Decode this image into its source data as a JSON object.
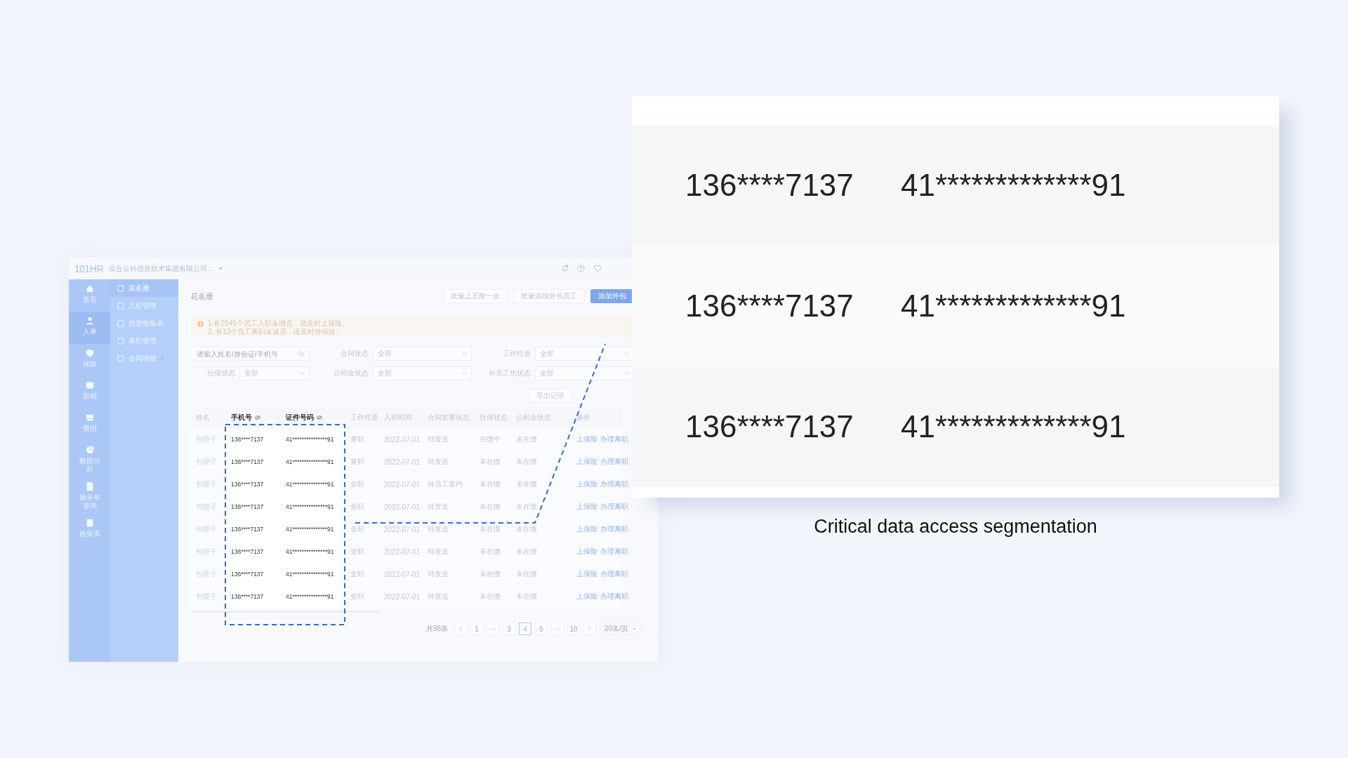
{
  "app": {
    "logo": "101HR",
    "company": "众合云科信息技术集团有限公司...",
    "rail": [
      {
        "label": "首页",
        "selected": false
      },
      {
        "label": "人事",
        "selected": true
      },
      {
        "label": "保险",
        "selected": false
      },
      {
        "label": "薪税",
        "selected": false
      },
      {
        "label": "费用",
        "selected": false
      },
      {
        "label": "数据分析",
        "selected": false
      },
      {
        "label": "服务单查询",
        "selected": false
      },
      {
        "label": "政策库",
        "selected": false
      }
    ],
    "submenu": [
      {
        "label": "花名册",
        "selected": true,
        "badge": false
      },
      {
        "label": "入职管理",
        "selected": false,
        "badge": false
      },
      {
        "label": "信息收集表",
        "selected": false,
        "badge": false
      },
      {
        "label": "离职管理",
        "selected": false,
        "badge": false
      },
      {
        "label": "合同续签",
        "selected": false,
        "badge": true
      }
    ],
    "page_title": "花名册",
    "actions": [
      {
        "label": "批量上五险一金",
        "kind": "default"
      },
      {
        "label": "批量添加外包员工",
        "kind": "default"
      },
      {
        "label": "添加外包",
        "kind": "primary"
      }
    ],
    "alerts": [
      "1.有2545个员工入职未增员，请及时上保险。",
      "2. 有13个员工离职未减员，请及时停保险。"
    ],
    "search": {
      "placeholder": "请输入姓名/身份证/手机号"
    },
    "filters": [
      {
        "label": "合同状态",
        "value": "全部"
      },
      {
        "label": "工作性质",
        "value": "全部"
      },
      {
        "label": "社保状态",
        "value": "全部"
      },
      {
        "label": "公积金状态",
        "value": "全部"
      },
      {
        "label": "补充工伤状态",
        "value": "全部"
      }
    ],
    "export_button": "导出记录",
    "table": {
      "columns": [
        "姓名",
        "手机号",
        "证件号码",
        "工作性质",
        "入职时间",
        "合同签署状态",
        "社保状态",
        "公积金状态",
        "操作"
      ],
      "rows": [
        {
          "name": "包饺子",
          "phone": "136****7137",
          "id": "41***************91",
          "work": "兼职",
          "date": "2022-07-01",
          "contract": "待发送",
          "social": "在缴中",
          "fund": "未在缴",
          "actions": [
            "上保险",
            "办理离职"
          ]
        },
        {
          "name": "包饺子",
          "phone": "136****7137",
          "id": "41***************91",
          "work": "兼职",
          "date": "2022-07-01",
          "contract": "待发送",
          "social": "未在缴",
          "fund": "未在缴",
          "actions": [
            "上保险",
            "办理离职"
          ]
        },
        {
          "name": "包饺子",
          "phone": "136****7137",
          "id": "41***************91",
          "work": "全职",
          "date": "2022-07-01",
          "contract": "待员工签约",
          "social": "未在缴",
          "fund": "未在缴",
          "actions": [
            "上保险",
            "办理离职"
          ]
        },
        {
          "name": "包饺子",
          "phone": "136****7137",
          "id": "41***************91",
          "work": "全职",
          "date": "2022-07-01",
          "contract": "待发送",
          "social": "未在缴",
          "fund": "未在缴",
          "actions": [
            "上保险",
            "办理离职"
          ]
        },
        {
          "name": "包饺子",
          "phone": "136****7137",
          "id": "41***************91",
          "work": "全职",
          "date": "2022-07-01",
          "contract": "待发送",
          "social": "未在缴",
          "fund": "未在缴",
          "actions": [
            "上保险",
            "办理离职"
          ]
        },
        {
          "name": "包饺子",
          "phone": "136****7137",
          "id": "41***************91",
          "work": "全职",
          "date": "2022-07-01",
          "contract": "待发送",
          "social": "未在缴",
          "fund": "未在缴",
          "actions": [
            "上保险",
            "办理离职"
          ]
        },
        {
          "name": "包饺子",
          "phone": "136****7137",
          "id": "41***************91",
          "work": "全职",
          "date": "2022-07-01",
          "contract": "待发送",
          "social": "未在缴",
          "fund": "未在缴",
          "actions": [
            "上保险",
            "办理离职"
          ]
        },
        {
          "name": "包饺子",
          "phone": "136****7137",
          "id": "41***************91",
          "work": "全职",
          "date": "2022-07-01",
          "contract": "待发送",
          "social": "未在缴",
          "fund": "未在缴",
          "actions": [
            "上保险",
            "办理离职"
          ]
        }
      ]
    },
    "pagination": {
      "total": "共98条",
      "pages": [
        {
          "label": "1",
          "selected": false
        },
        {
          "label": "···",
          "selected": false
        },
        {
          "label": "3",
          "selected": false
        },
        {
          "label": "4",
          "selected": true
        },
        {
          "label": "5",
          "selected": false
        },
        {
          "label": "···",
          "selected": false
        },
        {
          "label": "10",
          "selected": false
        }
      ],
      "page_size": "20条/页"
    }
  },
  "zoom_card": {
    "rows": [
      {
        "phone": "136****7137",
        "id": "41*************91"
      },
      {
        "phone": "136****7137",
        "id": "41*************91"
      },
      {
        "phone": "136****7137",
        "id": "41*************91"
      }
    ]
  },
  "caption": "Critical data access segmentation"
}
